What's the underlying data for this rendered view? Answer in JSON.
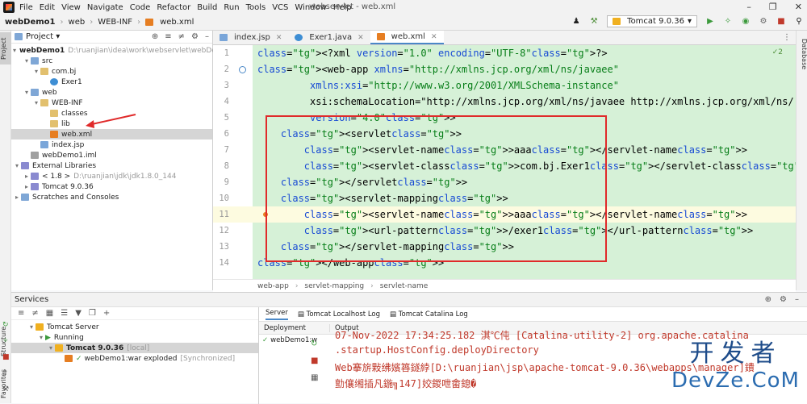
{
  "menu": {
    "items": [
      "File",
      "Edit",
      "View",
      "Navigate",
      "Code",
      "Refactor",
      "Build",
      "Run",
      "Tools",
      "VCS",
      "Window",
      "Help"
    ],
    "window_title": "webservlet - web.xml"
  },
  "nav": {
    "crumbs": [
      "webDemo1",
      "web",
      "WEB-INF",
      "web.xml"
    ],
    "run_config": "Tomcat 9.0.36"
  },
  "left_strip": {
    "project_tab": "Project",
    "structure_tab": "Structure",
    "favorites_tab": "Favorites"
  },
  "right_strip": {
    "database_tab": "Database"
  },
  "project": {
    "title": "Project",
    "tree": [
      {
        "label": "webDemo1",
        "extra": "D:\\ruanjian\\idea\\work\\webservlet\\webDemo1"
      },
      {
        "label": "src"
      },
      {
        "label": "com.bj"
      },
      {
        "label": "Exer1"
      },
      {
        "label": "web"
      },
      {
        "label": "WEB-INF"
      },
      {
        "label": "classes"
      },
      {
        "label": "lib"
      },
      {
        "label": "web.xml"
      },
      {
        "label": "index.jsp"
      },
      {
        "label": "webDemo1.iml"
      },
      {
        "label": "External Libraries"
      },
      {
        "label": "< 1.8 >",
        "extra": "D:\\ruanjian\\jdk\\jdk1.8.0_144"
      },
      {
        "label": "Tomcat 9.0.36"
      },
      {
        "label": "Scratches and Consoles"
      }
    ]
  },
  "tabs": [
    {
      "label": "index.jsp"
    },
    {
      "label": "Exer1.java"
    },
    {
      "label": "web.xml"
    }
  ],
  "editor": {
    "inspection": "2",
    "line_numbers": [
      "1",
      "2",
      "3",
      "4",
      "5",
      "6",
      "7",
      "8",
      "9",
      "10",
      "11",
      "12",
      "13",
      "14"
    ],
    "lines": [
      {
        "indent": "",
        "text": "<?xml version=\"1.0\" encoding=\"UTF-8\"?>"
      },
      {
        "indent": "",
        "text": "<web-app xmlns=\"http://xmlns.jcp.org/xml/ns/javaee\""
      },
      {
        "indent": "         ",
        "text": "xmlns:xsi=\"http://www.w3.org/2001/XMLSchema-instance\""
      },
      {
        "indent": "         ",
        "text": "xsi:schemaLocation=\"http://xmlns.jcp.org/xml/ns/javaee http://xmlns.jcp.org/xml/ns/"
      },
      {
        "indent": "         ",
        "text": "version=\"4.0\">"
      },
      {
        "indent": "    ",
        "text": "<servlet>"
      },
      {
        "indent": "        ",
        "text": "<servlet-name>aaa</servlet-name>"
      },
      {
        "indent": "        ",
        "text": "<servlet-class>com.bj.Exer1</servlet-class>"
      },
      {
        "indent": "    ",
        "text": "</servlet>"
      },
      {
        "indent": "    ",
        "text": "<servlet-mapping>"
      },
      {
        "indent": "        ",
        "text": "<servlet-name>aaa</servlet-name>"
      },
      {
        "indent": "        ",
        "text": "<url-pattern>/exer1</url-pattern>"
      },
      {
        "indent": "    ",
        "text": "</servlet-mapping>"
      },
      {
        "indent": "",
        "text": "</web-app>"
      }
    ],
    "breadcrumb": [
      "web-app",
      "servlet-mapping",
      "servlet-name"
    ]
  },
  "services": {
    "title": "Services",
    "tree": [
      {
        "label": "Tomcat Server",
        "extra": ""
      },
      {
        "label": "Running",
        "extra": ""
      },
      {
        "label": "Tomcat 9.0.36",
        "extra": "[local]"
      },
      {
        "label": "webDemo1:war exploded",
        "extra": "[Synchronized]"
      }
    ],
    "right_tabs": [
      "Server",
      "Tomcat Localhost Log",
      "Tomcat Catalina Log"
    ],
    "deployment_header": "Deployment",
    "output_header": "Output",
    "deployment_item": "webDemo1:w",
    "output_lines": [
      "07-Nov-2022 17:34:25.182 淇℃伅 [Catalina-utility-2] org.apache.catalina",
      ".startup.HostConfig.deployDirectory",
      "Web搴旂敤绋嬪簭鐩綍[D:\\ruanjian\\jsp\\apache-tomcat-9.0.36\\webapps\\manager]鐨",
      "勯儴缃插凡鍦╗147]姣鍐呭畬鎴�"
    ]
  },
  "watermark": {
    "top": "开发者",
    "bottom": "DevZe.CoM"
  }
}
